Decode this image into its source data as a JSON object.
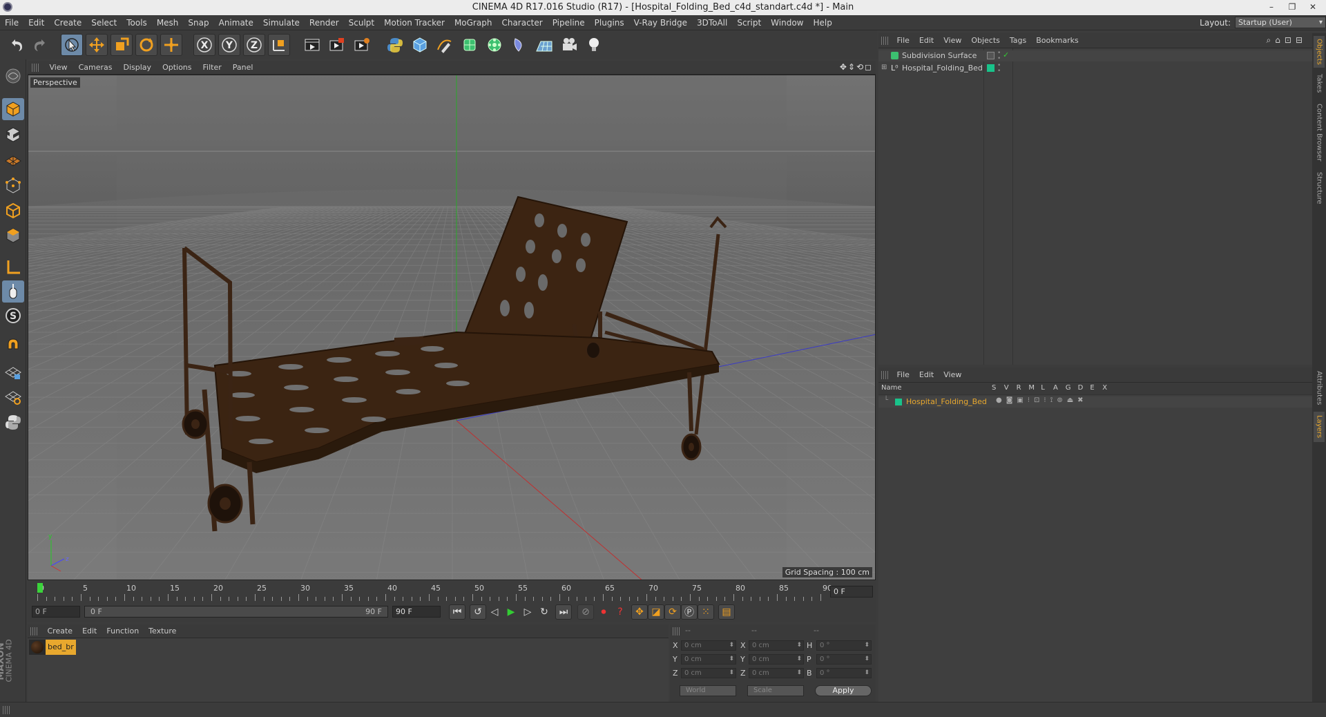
{
  "window": {
    "title": "CINEMA 4D R17.016 Studio (R17) - [Hospital_Folding_Bed_c4d_standart.c4d *] - Main",
    "minimize": "–",
    "restore": "❐",
    "close": "✕"
  },
  "menubar": {
    "items": [
      "File",
      "Edit",
      "Create",
      "Select",
      "Tools",
      "Mesh",
      "Snap",
      "Animate",
      "Simulate",
      "Render",
      "Sculpt",
      "Motion Tracker",
      "MoGraph",
      "Character",
      "Pipeline",
      "Plugins",
      "V-Ray Bridge",
      "3DToAll",
      "Script",
      "Window",
      "Help"
    ],
    "layout_label": "Layout:",
    "layout_value": "Startup (User)"
  },
  "toolbar": {
    "axis_x": "X",
    "axis_y": "Y",
    "axis_z": "Z"
  },
  "viewport": {
    "menu": [
      "View",
      "Cameras",
      "Display",
      "Options",
      "Filter",
      "Panel"
    ],
    "label": "Perspective",
    "grid_spacing": "Grid Spacing : 100 cm",
    "nav_icons": "✥⇕⟲◻"
  },
  "timeline": {
    "ticks": [
      "0",
      "5",
      "10",
      "15",
      "20",
      "25",
      "30",
      "35",
      "40",
      "45",
      "50",
      "55",
      "60",
      "65",
      "70",
      "75",
      "80",
      "85",
      "90"
    ],
    "current_frame": "0 F",
    "start_field": "0 F",
    "slider_start": "0 F",
    "slider_end": "90 F",
    "end_field": "90 F"
  },
  "material_manager": {
    "menu": [
      "Create",
      "Edit",
      "Function",
      "Texture"
    ],
    "materials": [
      {
        "name": "bed_br"
      }
    ]
  },
  "coordinates": {
    "headers": [
      "--",
      "--",
      "--"
    ],
    "rows": [
      {
        "a1": "X",
        "v1": "0 cm",
        "a2": "X",
        "v2": "0 cm",
        "a3": "H",
        "v3": "0 °"
      },
      {
        "a1": "Y",
        "v1": "0 cm",
        "a2": "Y",
        "v2": "0 cm",
        "a3": "P",
        "v3": "0 °"
      },
      {
        "a1": "Z",
        "v1": "0 cm",
        "a2": "Z",
        "v2": "0 cm",
        "a3": "B",
        "v3": "0 °"
      }
    ],
    "mode_world": "World",
    "mode_scale": "Scale",
    "apply": "Apply"
  },
  "object_manager": {
    "menu": [
      "File",
      "Edit",
      "View",
      "Objects",
      "Tags",
      "Bookmarks"
    ],
    "objects": [
      {
        "name": "Subdivision Surface"
      },
      {
        "name": "Hospital_Folding_Bed"
      }
    ]
  },
  "layer_manager": {
    "menu": [
      "File",
      "Edit",
      "View"
    ],
    "columns": {
      "name": "Name",
      "flags": [
        "S",
        "V",
        "R",
        "M",
        "L",
        "A",
        "G",
        "D",
        "E",
        "X"
      ]
    },
    "layers": [
      {
        "name": "Hospital_Folding_Bed",
        "color": "#19c38a"
      }
    ]
  },
  "side_tabs": [
    "Objects",
    "Takes",
    "Content Browser",
    "Structure",
    "Attributes",
    "Layers"
  ],
  "brand": {
    "maxon": "MAXON",
    "cinema": "CINEMA 4D"
  },
  "colors": {
    "accent": "#e8a82e",
    "selection_blue": "#6d8aa8",
    "layer_green": "#19c38a"
  }
}
